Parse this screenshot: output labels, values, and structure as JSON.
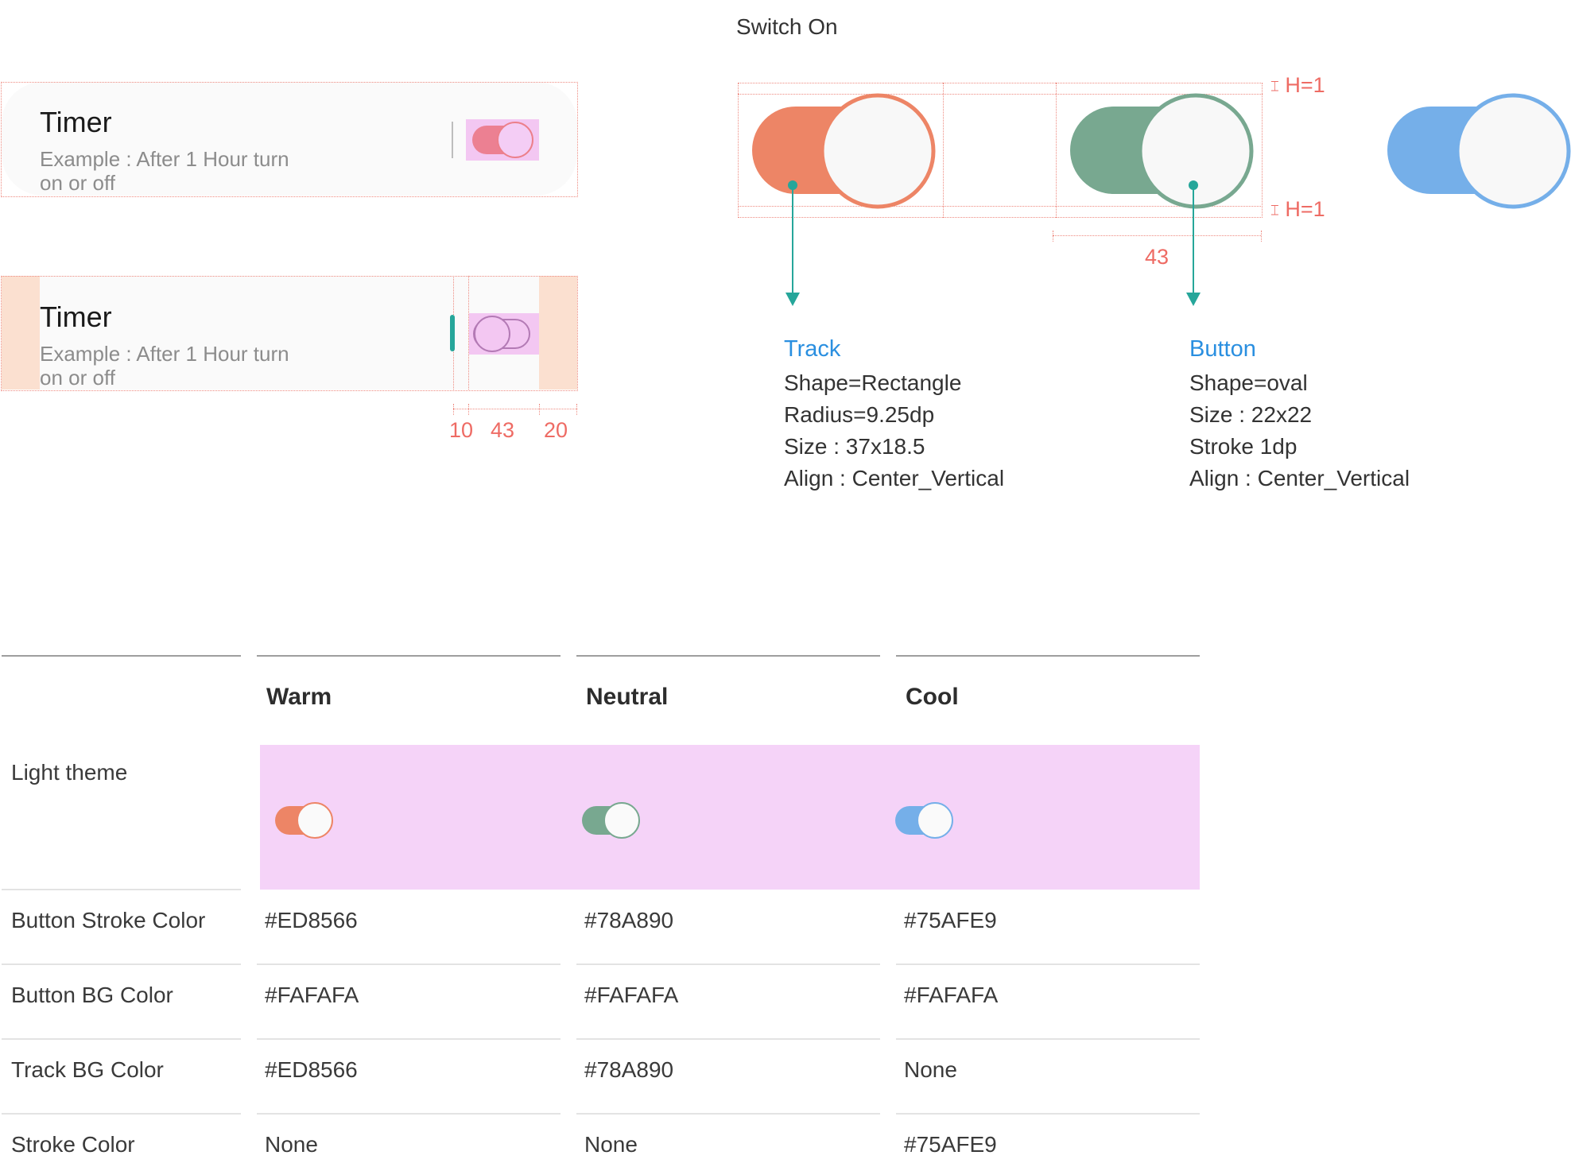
{
  "header": {
    "title": "Switch On"
  },
  "cards": [
    {
      "title": "Timer",
      "subtitle_line1": "Example : After 1 Hour turn",
      "subtitle_line2": "on or off"
    },
    {
      "title": "Timer",
      "subtitle_line1": "Example : After 1 Hour turn",
      "subtitle_line2": "on or off"
    }
  ],
  "card_dimensions": {
    "left": "10",
    "middle": "43",
    "right": "20"
  },
  "switch_spec": {
    "height_top": "H=1",
    "height_bottom": "H=1",
    "width": "43"
  },
  "track": {
    "heading": "Track",
    "shape": "Shape=Rectangle",
    "radius": "Radius=9.25dp",
    "size": "Size : 37x18.5",
    "align": "Align : Center_Vertical"
  },
  "button": {
    "heading": "Button",
    "shape": "Shape=oval",
    "size": "Size : 22x22",
    "stroke": "Stroke 1dp",
    "align": "Align : Center_Vertical"
  },
  "colors": {
    "warm": "#ED8566",
    "neutral": "#78A890",
    "cool": "#75AFE9",
    "button_bg": "#FAFAFA",
    "highlight": "#F5D3F8"
  },
  "table": {
    "columns": [
      "Warm",
      "Neutral",
      "Cool"
    ],
    "theme_label": "Light theme",
    "rows": [
      {
        "label": "Button Stroke Color",
        "values": [
          "#ED8566",
          "#78A890",
          "#75AFE9"
        ]
      },
      {
        "label": "Button BG Color",
        "values": [
          "#FAFAFA",
          "#FAFAFA",
          "#FAFAFA"
        ]
      },
      {
        "label": "Track BG Color",
        "values": [
          "#ED8566",
          "#78A890",
          "None"
        ]
      },
      {
        "label": "Stroke Color",
        "values": [
          "None",
          "None",
          "#75AFE9"
        ]
      }
    ]
  }
}
